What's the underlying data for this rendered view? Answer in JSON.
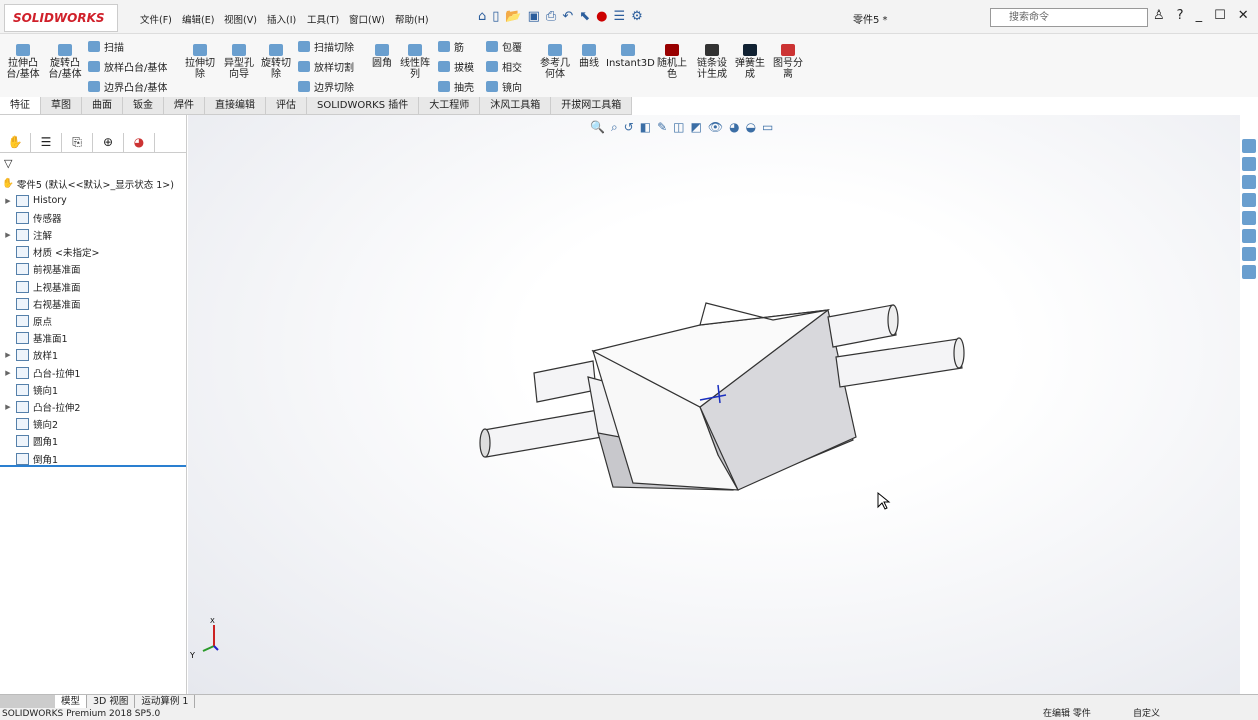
{
  "app": {
    "logo": "SOLIDWORKS",
    "doc_title": "零件5 *",
    "search_placeholder": "搜索命令"
  },
  "menu": [
    "文件(F)",
    "编辑(E)",
    "视图(V)",
    "插入(I)",
    "工具(T)",
    "窗口(W)",
    "帮助(H)"
  ],
  "ribbon": {
    "big": [
      "拉伸凸台/基体",
      "旋转凸台/基体",
      "拉伸切除",
      "异型孔向导",
      "旋转切除",
      "圆角",
      "线性阵列",
      "参考几何体",
      "曲线",
      "Instant3D",
      "随机上色",
      "链条设计生成",
      "弹簧生成",
      "图号分离"
    ],
    "small": [
      "扫描",
      "放样凸台/基体",
      "边界凸台/基体",
      "扫描切除",
      "放样切割",
      "边界切除",
      "筋",
      "拔模",
      "抽壳",
      "包覆",
      "相交",
      "镜向"
    ]
  },
  "tabs": [
    "特征",
    "草图",
    "曲面",
    "钣金",
    "焊件",
    "直接编辑",
    "评估",
    "SOLIDWORKS 插件",
    "大工程师",
    "沐风工具箱",
    "开拔网工具箱"
  ],
  "tree": {
    "root": "零件5 (默认<<默认>_显示状态 1>)",
    "items": [
      {
        "label": "History",
        "exp": true
      },
      {
        "label": "传感器",
        "exp": false
      },
      {
        "label": "注解",
        "exp": true
      },
      {
        "label": "材质 <未指定>",
        "exp": false
      },
      {
        "label": "前视基准面",
        "exp": false
      },
      {
        "label": "上视基准面",
        "exp": false
      },
      {
        "label": "右视基准面",
        "exp": false
      },
      {
        "label": "原点",
        "exp": false
      },
      {
        "label": "基准面1",
        "exp": false
      },
      {
        "label": "放样1",
        "exp": true
      },
      {
        "label": "凸台-拉伸1",
        "exp": true
      },
      {
        "label": "镜向1",
        "exp": false
      },
      {
        "label": "凸台-拉伸2",
        "exp": true
      },
      {
        "label": "镜向2",
        "exp": false
      },
      {
        "label": "圆角1",
        "exp": false
      },
      {
        "label": "倒角1",
        "exp": false
      }
    ]
  },
  "bottom_tabs": [
    "模型",
    "3D 视图",
    "运动算例 1"
  ],
  "status": {
    "version": "SOLIDWORKS Premium 2018 SP5.0",
    "editing": "在编辑 零件",
    "custom": "自定义"
  },
  "triad": {
    "x": "X",
    "y": "Y"
  }
}
